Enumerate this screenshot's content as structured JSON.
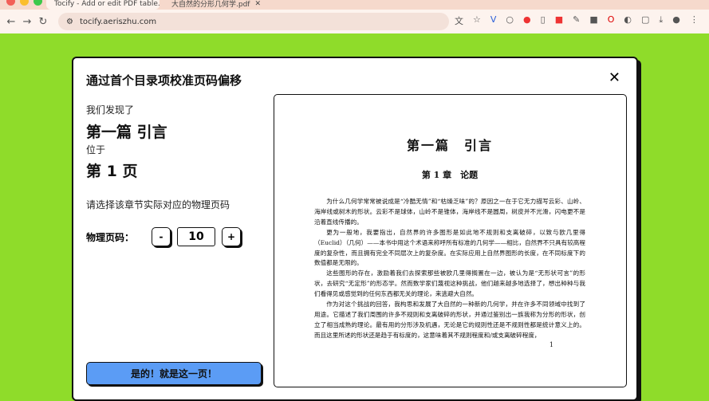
{
  "browser": {
    "tabs": [
      {
        "title": "Tocify - Add or edit PDF table..."
      },
      {
        "title": "大自然的分形几何学.pdf"
      }
    ],
    "url": "tocify.aeriszhu.com"
  },
  "modal": {
    "title": "通过首个目录项校准页码偏移",
    "found_label": "我们发现了",
    "chapter_title": "第一篇 引言",
    "located_label": "位于",
    "page_label": "第 1 页",
    "instruction": "请选择该章节实际对应的物理页码",
    "physical_page_label": "物理页码：",
    "decrement": "-",
    "physical_page_value": "10",
    "increment": "+",
    "confirm_button": "是的！就是这一页！",
    "close": "✕"
  },
  "preview": {
    "heading": "第一篇　引言",
    "chapter": "第 1 章　论题",
    "paragraphs": [
      "为什么几何学常常被说成是“冷酷无情”和“枯燥乏味”的？原因之一在于它无力描写云彩、山岭、海岸线或树木的形状。云彩不是球体，山岭不是锥体，海岸线不是圆周，树皮并不光滑，闪电更不是沿着直线传播的。",
      "更为一般地，我要指出，自然界的许多图形是如此地不规则和支离破碎，以致与欧几里得（Euclid）（几何）——本书中用这个术语来称呼所有标准的几何学——相比，自然界不只具有较高程度的复杂性，而且拥有完全不同层次上的复杂度。在实际应用上自然界图形的长度，在不同标度下的数值都是无限的。",
      "这些图形的存在，激励着我们去探索那些被欧几里得搁置在一边，被认为是“无形状可言”的形状，去研究“无定形”的形态学。然而数学家们蔑视这种挑战，他们越来越多地选择了，想出种种与我们看得见或感觉到的任何东西都无关的理论，来逃避大自然。",
      "作为对这个挑战的回答，我构思和发展了大自然的一种新的几何学，并在许多不同领域中找到了用途。它描述了我们周围的许多不规则和支离破碎的形状，并通过鉴别出一族我称为分形的形状，创立了相当成熟的理论。最有用的分形涉及机遇，无论是它的规则性还是不规则性都是统计意义上的。而且这里所述的形状还是趋于有标度的，这意味着其不规则程度和/或支离破碎程度，"
    ],
    "page_number": "1"
  }
}
